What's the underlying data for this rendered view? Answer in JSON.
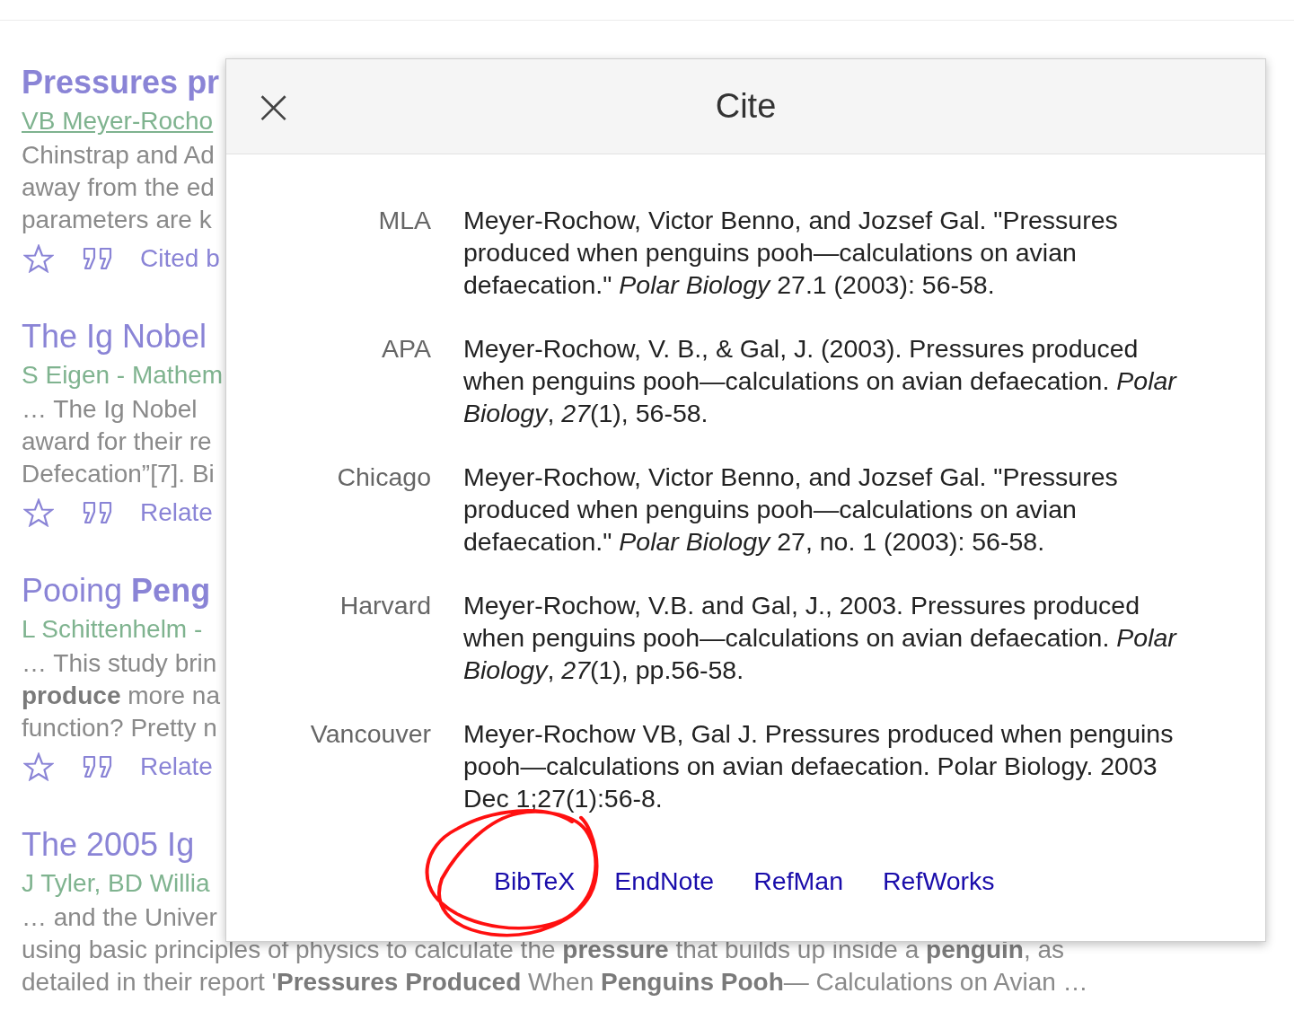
{
  "results": [
    {
      "title": "**Pressures pr**",
      "authors": "VB Meyer-Rocho",
      "authors_underlined": true,
      "snippet": [
        "Chinstrap and Ad",
        "away from the ed",
        "parameters are k"
      ],
      "action": "Cited b"
    },
    {
      "title": "The Ig Nobel",
      "authors": "S Eigen - Mathem",
      "authors_underlined": false,
      "snippet": [
        "… The Ig Nobel",
        "award for their re",
        "Defecation”[7]. Bi"
      ],
      "action": "Relate"
    },
    {
      "title": "Pooing **Peng**",
      "authors": "L Schittenhelm -",
      "authors_underlined": false,
      "snippet": [
        "… This study brin",
        "**produce** more na",
        "function? Pretty n"
      ],
      "action": "Relate"
    },
    {
      "title": "The 2005 Ig",
      "authors": "J Tyler, BD Willia",
      "authors_underlined": false,
      "snippet": [
        "… and the Univer",
        "using basic principles of physics to calculate the **pressure** that builds up inside a **penguin**, as",
        "detailed in their report '**Pressures Produced** When **Penguins Pooh**— Calculations on Avian …"
      ]
    }
  ],
  "dialog": {
    "title": "Cite",
    "close": "×",
    "citations": [
      {
        "style": "MLA",
        "text": "Meyer-Rochow, Victor Benno, and Jozsef Gal. \"Pressures produced when penguins pooh—calculations on avian defaecation.\" *Polar Biology* 27.1 (2003): 56-58."
      },
      {
        "style": "APA",
        "text": "Meyer-Rochow, V. B., & Gal, J. (2003). Pressures produced when penguins pooh—calculations on avian defaecation. *Polar Biology*, *27*(1), 56-58."
      },
      {
        "style": "Chicago",
        "text": "Meyer-Rochow, Victor Benno, and Jozsef Gal. \"Pressures produced when penguins pooh—calculations on avian defaecation.\" *Polar Biology* 27, no. 1 (2003): 56-58."
      },
      {
        "style": "Harvard",
        "text": "Meyer-Rochow, V.B. and Gal, J., 2003. Pressures produced when penguins pooh—calculations on avian defaecation. *Polar Biology*, *27*(1), pp.56-58."
      },
      {
        "style": "Vancouver",
        "text": "Meyer-Rochow VB, Gal J. Pressures produced when penguins pooh—calculations on avian defaecation. Polar Biology. 2003 Dec 1;27(1):56-8."
      }
    ],
    "exports": [
      {
        "label": "BibTeX",
        "circled": true
      },
      {
        "label": "EndNote",
        "circled": false
      },
      {
        "label": "RefMan",
        "circled": false
      },
      {
        "label": "RefWorks",
        "circled": false
      }
    ]
  }
}
